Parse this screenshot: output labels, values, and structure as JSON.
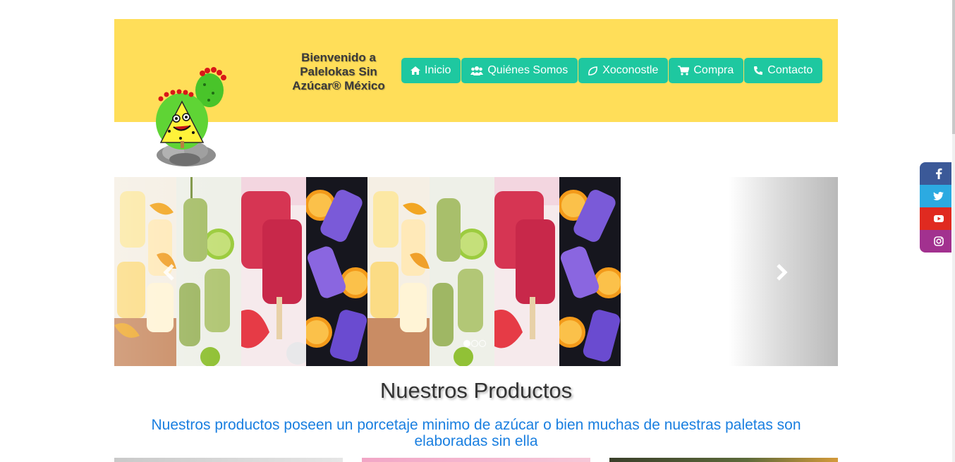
{
  "header": {
    "welcome": "Bienvenido a Palelokas Sin Azúcar® México",
    "background": "#ffde59",
    "logo_icon": "cactus-mascot-logo"
  },
  "nav": [
    {
      "label": "Inicio",
      "icon": "home-icon"
    },
    {
      "label": "Quiénes Somos",
      "icon": "users-icon"
    },
    {
      "label": "Xoconostle",
      "icon": "leaf-icon"
    },
    {
      "label": "Compra",
      "icon": "cart-icon"
    },
    {
      "label": "Contacto",
      "icon": "phone-icon"
    }
  ],
  "nav_color": "#1ec8a0",
  "carousel": {
    "slides_count": 3,
    "active_index": 0,
    "prev_icon": "chevron-left-icon",
    "next_icon": "chevron-right-icon"
  },
  "social": [
    {
      "name": "facebook-icon",
      "color": "#3b5998"
    },
    {
      "name": "twitter-icon",
      "color": "#2caae1"
    },
    {
      "name": "youtube-icon",
      "color": "#e02a20"
    },
    {
      "name": "instagram-icon",
      "color": "#a2318f"
    }
  ],
  "products": {
    "title": "Nuestros Productos",
    "subtitle": "Nuestros productos poseen un porcetaje minimo de azúcar o bien muchas de nuestras paletas son elaboradas sin ella"
  }
}
